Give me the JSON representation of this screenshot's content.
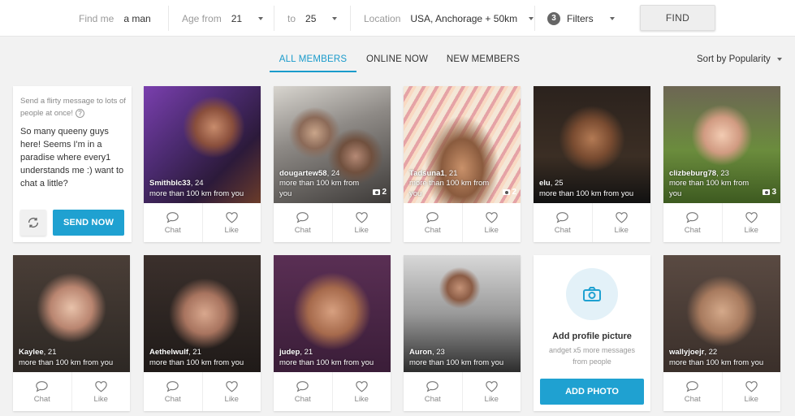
{
  "search": {
    "find_label": "Find me",
    "find_value": "a man",
    "age_from_label": "Age from",
    "age_from_value": "21",
    "age_to_label": "to",
    "age_to_value": "25",
    "location_label": "Location",
    "location_value": "USA, Anchorage + 50km",
    "filters_count": "3",
    "filters_label": "Filters",
    "find_button": "FIND"
  },
  "tabs": [
    {
      "label": "ALL MEMBERS",
      "active": true
    },
    {
      "label": "ONLINE NOW",
      "active": false
    },
    {
      "label": "NEW MEMBERS",
      "active": false
    }
  ],
  "sort_label": "Sort by Popularity",
  "message_card": {
    "hint": "Send a flirty message to lots of people at once!",
    "help_icon": "?",
    "body": "So many queeny guys here! Seems I'm in a paradise where every1 understands me :) want to chat a little?",
    "send_button": "SEND NOW"
  },
  "action_labels": {
    "chat": "Chat",
    "like": "Like"
  },
  "members": [
    {
      "name": "Smithblc33",
      "age": ", 24",
      "distance": "more than 100 km from you",
      "photos": ""
    },
    {
      "name": "dougartew58",
      "age": ", 24",
      "distance": "more than 100 km from you",
      "photos": "2"
    },
    {
      "name": "Tadsuna1",
      "age": ", 21",
      "distance": "more than 100 km from you",
      "photos": "2"
    },
    {
      "name": "elu",
      "age": ", 25",
      "distance": "more than 100 km from you",
      "photos": ""
    },
    {
      "name": "clizbeburg78",
      "age": ", 23",
      "distance": "more than 100 km from you",
      "photos": "3"
    },
    {
      "name": "Kaylee",
      "age": ", 21",
      "distance": "more than 100 km from you",
      "photos": ""
    },
    {
      "name": "Aethelwulf",
      "age": ", 21",
      "distance": "more than 100 km from you",
      "photos": ""
    },
    {
      "name": "judep",
      "age": ", 21",
      "distance": "more than 100 km from you",
      "photos": ""
    },
    {
      "name": "Auron",
      "age": ", 23",
      "distance": "more than 100 km from you",
      "photos": ""
    },
    {
      "name": "wallyjoejr",
      "age": ", 22",
      "distance": "more than 100 km from you",
      "photos": ""
    }
  ],
  "add_photo_card": {
    "title": "Add profile picture",
    "subtitle": "andget x5 more messages from people",
    "button": "ADD PHOTO"
  },
  "colors": {
    "accent": "#1fa1d1",
    "tab_active": "#1a9bcb"
  },
  "icons": [
    "chevron-down-icon",
    "chat-bubble-icon",
    "heart-icon",
    "camera-icon",
    "refresh-icon",
    "help-icon"
  ]
}
